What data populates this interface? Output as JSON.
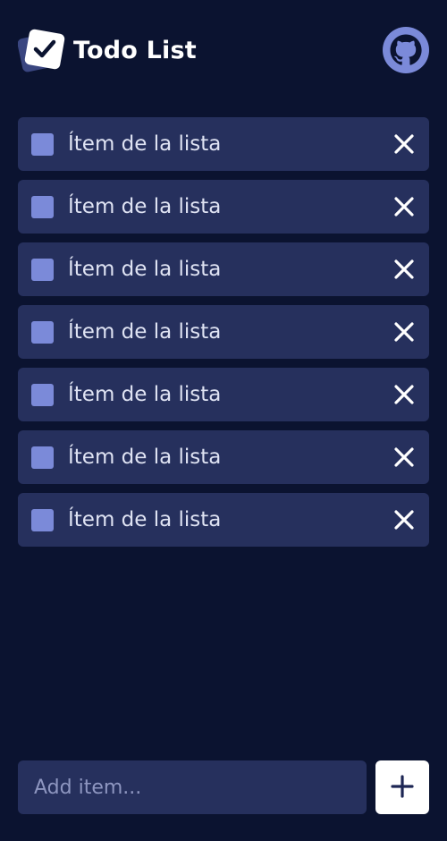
{
  "header": {
    "title": "Todo List",
    "logo_icon": "checkbox-logo-icon",
    "github_icon": "github-icon"
  },
  "items": [
    {
      "label": "Ítem de la lista",
      "checked": false
    },
    {
      "label": "Ítem de la lista",
      "checked": false
    },
    {
      "label": "Ítem de la lista",
      "checked": false
    },
    {
      "label": "Ítem de la lista",
      "checked": false
    },
    {
      "label": "Ítem de la lista",
      "checked": false
    },
    {
      "label": "Ítem de la lista",
      "checked": false
    },
    {
      "label": "Ítem de la lista",
      "checked": false
    }
  ],
  "footer": {
    "input_value": "",
    "input_placeholder": "Add item...",
    "add_icon": "plus-icon"
  },
  "colors": {
    "background": "#0b1330",
    "item_background": "#26305d",
    "checkbox": "#7b8ad9",
    "github_circle": "#7b8ad9",
    "text": "#dfe3f3",
    "add_button": "#ffffff"
  }
}
